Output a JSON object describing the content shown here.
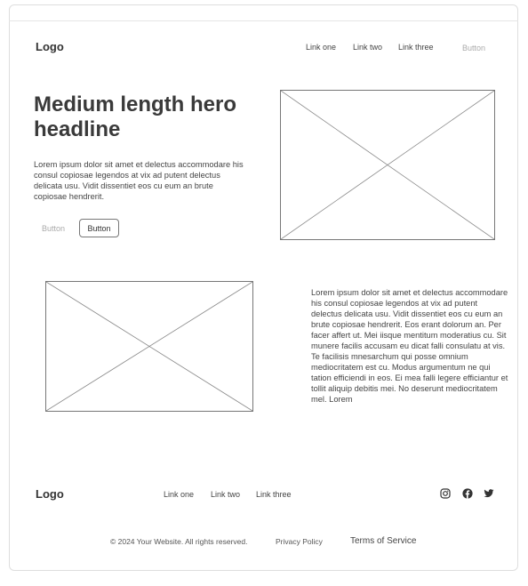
{
  "header": {
    "logo": "Logo",
    "nav": [
      "Link one",
      "Link two",
      "Link three"
    ],
    "button": "Button"
  },
  "hero": {
    "headline": "Medium length hero headline",
    "text": "Lorem ipsum dolor sit amet et delectus accommodare his consul copiosae legendos at vix ad putent delectus delicata usu. Vidit dissentiet eos cu eum an brute copiosae hendrerit.",
    "ghost_button": "Button",
    "outline_button": "Button"
  },
  "feature": {
    "text": "Lorem ipsum dolor sit amet et delectus accommodare his consul copiosae legendos at vix ad putent delectus delicata usu. Vidit dissentiet eos cu eum an brute copiosae hendrerit. Eos erant dolorum an. Per facer affert ut. Mei iisque mentitum moderatius cu. Sit munere facilis accusam eu dicat falli consulatu at vis. Te facilisis mnesarchum qui posse omnium mediocritatem est cu. Modus argumentum ne qui tation efficiendi in eos. Ei mea falli legere efficiantur et tollit aliquip debitis mei. No deserunt mediocritatem mel. Lorem"
  },
  "footer": {
    "logo": "Logo",
    "nav": [
      "Link one",
      "Link two",
      "Link three"
    ],
    "social_icons": [
      "instagram-icon",
      "facebook-icon",
      "twitter-icon"
    ],
    "copyright": "© 2024 Your Website. All rights reserved.",
    "privacy": "Privacy Policy",
    "terms": "Terms of Service"
  },
  "colors": {
    "text": "#333333",
    "border": "#777777",
    "muted": "#aaaaaa"
  }
}
